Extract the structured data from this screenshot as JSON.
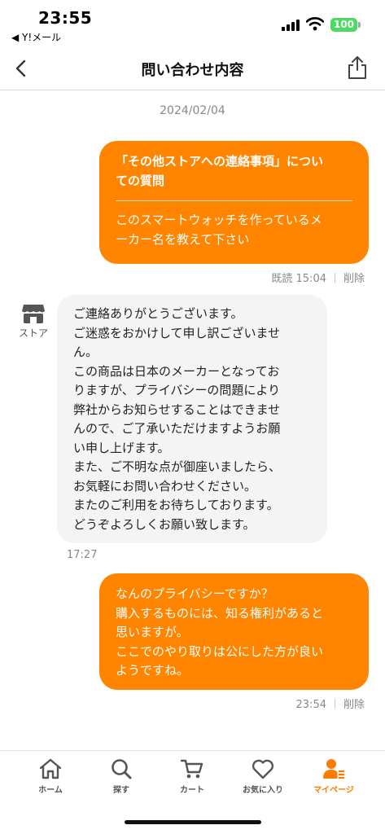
{
  "status_bar": {
    "time": "23:55",
    "back_app": "◀ Y!メール",
    "battery": "100"
  },
  "nav": {
    "title": "問い合わせ内容"
  },
  "chat": {
    "date": "2024/02/04",
    "messages": [
      {
        "direction": "outgoing",
        "subject_lines": [
          "「その他ストアへの連絡事項」につい",
          "ての質問"
        ],
        "body_lines": [
          "このスマートウォッチを作っているメ",
          "ーカー名を教えて下さい"
        ],
        "read_status": "既読",
        "time": "15:04",
        "delete_label": "削除"
      },
      {
        "direction": "incoming",
        "sender_label": "ストア",
        "body_lines": [
          "ご連絡ありがとうございます。",
          "ご迷惑をおかけして申し訳ございませ",
          "ん。",
          "この商品は日本のメーカーとなってお",
          "りますが、プライバシーの問題により",
          "弊社からお知らせすることはできませ",
          "んので、ご了承いただけますようお願",
          "い申し上げます。",
          "また、ご不明な点が御座いましたら、",
          "お気軽にお問い合わせください。",
          "またのご利用をお待ちしております。",
          "どうぞよろしくお願い致します。"
        ],
        "time": "17:27"
      },
      {
        "direction": "outgoing",
        "body_lines": [
          "なんのプライバシーですか？",
          "購入するものには、知る権利があると",
          "思いますが。",
          "ここでのやり取りは公にした方が良い",
          "ようですね。"
        ],
        "time": "23:54",
        "delete_label": "削除"
      }
    ]
  },
  "tab_bar": {
    "items": [
      {
        "label": "ホーム",
        "icon": "home-icon",
        "active": false
      },
      {
        "label": "探す",
        "icon": "search-icon",
        "active": false
      },
      {
        "label": "カート",
        "icon": "cart-icon",
        "active": false
      },
      {
        "label": "お気に入り",
        "icon": "heart-icon",
        "active": false
      },
      {
        "label": "マイページ",
        "icon": "mypage-icon",
        "active": true
      }
    ]
  },
  "colors": {
    "accent": "#ff8400",
    "incoming_bubble": "#f4f4f4",
    "battery": "#4cd964"
  }
}
